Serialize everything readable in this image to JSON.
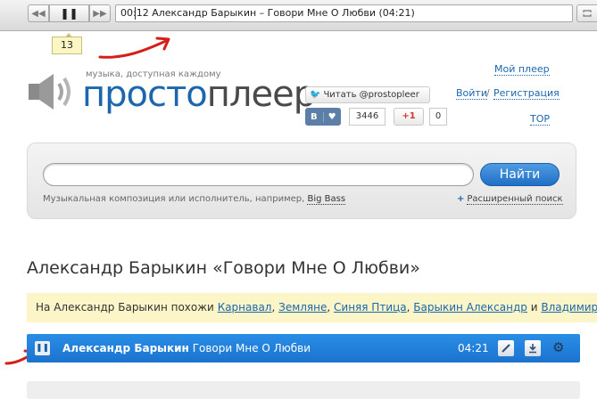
{
  "player": {
    "prev_icon": "◀◀",
    "pause_icon": "❚❚",
    "next_icon": "▶▶",
    "now_playing": "00:12 Александр Барыкин – Говори Мне О Любви (04:21)",
    "tooltip": "13"
  },
  "logo": {
    "tagline": "музыка, доступная каждому",
    "brand_part1": "просто",
    "brand_part2": "плеер"
  },
  "nav": {
    "my_player": "Мой плеер",
    "login": "Войти",
    "separator": "/",
    "register": "Регистрация",
    "top": "TOP"
  },
  "social": {
    "twitter_label": "Читать @prostopleer",
    "vk_label": "В",
    "vk_count": "3446",
    "gplus_label": "+1",
    "gplus_count": "0"
  },
  "search": {
    "value": "",
    "button": "Найти",
    "hint": "Музыкальная композиция или исполнитель, например,",
    "hint_example": "Big Bass",
    "advanced": "Расширенный поиск"
  },
  "page": {
    "title": "Александр Барыкин «Говори Мне О Любви»"
  },
  "similar": {
    "prefix": "На Александр Барыкин похожи",
    "artists": [
      "Карнавал",
      "Земляне",
      "Синяя Птица",
      "Барыкин Александр",
      "Владимир Кузьмин"
    ],
    "and_word": "и"
  },
  "track": {
    "artist": "Александр Барыкин",
    "title": "Говори Мне О Любви",
    "duration": "04:21"
  },
  "colors": {
    "accent": "#1c66ad",
    "annotation": "#d3201a",
    "track_bar": "#1b73cf"
  }
}
